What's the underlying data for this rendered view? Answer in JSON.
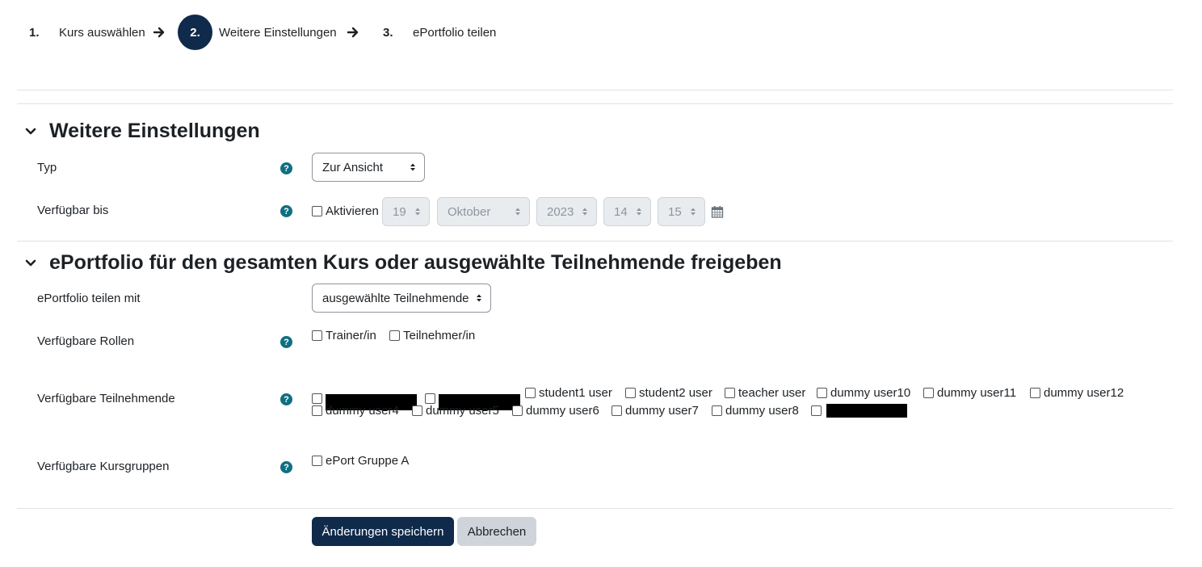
{
  "stepper": {
    "steps": [
      {
        "number": "1.",
        "label": "Kurs auswählen"
      },
      {
        "number": "2.",
        "label": "Weitere Einstellungen"
      },
      {
        "number": "3.",
        "label": "ePortfolio teilen"
      }
    ]
  },
  "section1": {
    "title": "Weitere Einstellungen",
    "typ_label": "Typ",
    "typ_value": "Zur Ansicht",
    "verfuegbar_label": "Verfügbar bis",
    "aktivieren_label": "Aktivieren",
    "day": "19",
    "month": "Oktober",
    "year": "2023",
    "hour": "14",
    "minute": "15"
  },
  "section2": {
    "title": "ePortfolio für den gesamten Kurs oder ausgewählte Teilnehmende freigeben",
    "share_label": "ePortfolio teilen mit",
    "share_value": "ausgewählte Teilnehmende",
    "roles_label": "Verfügbare Rollen",
    "roles": [
      "Trainer/in",
      "Teilnehmer/in"
    ],
    "participants_label": "Verfügbare Teilnehmende",
    "participants": [
      "student1 user",
      "student2 user",
      "teacher user",
      "dummy user10",
      "dummy user11",
      "dummy user12",
      "dummy user4",
      "dummy user5",
      "dummy user6",
      "dummy user7",
      "dummy user8"
    ],
    "groups_label": "Verfügbare Kursgruppen",
    "groups": [
      "ePort Gruppe A"
    ]
  },
  "buttons": {
    "save": "Änderungen speichern",
    "cancel": "Abbrechen"
  },
  "colors": {
    "primary": "#0f2a4a",
    "help": "#0f6f82"
  }
}
